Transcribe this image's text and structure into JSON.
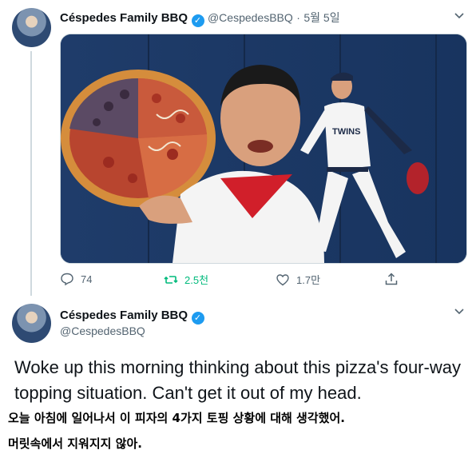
{
  "tweet1": {
    "display_name": "Céspedes Family BBQ",
    "handle": "@CespedesBBQ",
    "separator": "·",
    "date": "5월 5일",
    "stats": {
      "replies": "74",
      "retweets": "2.5천",
      "likes": "1.7만"
    }
  },
  "tweet2": {
    "display_name": "Céspedes Family BBQ",
    "handle": "@CespedesBBQ",
    "text": "Woke up this morning thinking about this pizza's four-way topping situation. Can't get it out of my head."
  },
  "caption": {
    "line1": "오늘 아침에 일어나서 이 피자의 4가지 토핑 상황에 대해 생각했어.",
    "line2": "머릿속에서 지워지지 않아."
  },
  "image": {
    "jersey_text": "TWINS"
  },
  "icons": [
    "chevron-down-icon",
    "verified-badge-icon",
    "reply-icon",
    "retweet-icon",
    "like-icon",
    "share-icon"
  ],
  "colors": {
    "verified": "#1d9bf0",
    "retweet": "#00ba7c",
    "muted": "#536471",
    "wall": "#1a3a6b"
  }
}
